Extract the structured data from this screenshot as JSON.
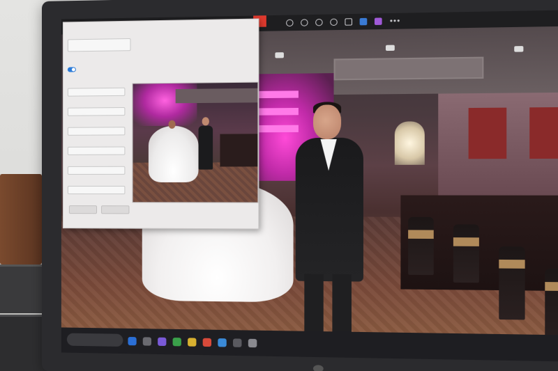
{
  "scene": {
    "description_visible_text": "",
    "dialog": {
      "title": "",
      "nav_arrows": ""
    }
  },
  "toolbar_icons": [
    "rotate-icon",
    "heart-icon",
    "info-icon",
    "edit-icon",
    "crop-icon",
    "cloud-icon",
    "app-icon",
    "more-icon"
  ],
  "taskbar_icons": [
    "windows-icon",
    "search-icon",
    "widgets-icon",
    "chat-icon",
    "explorer-icon",
    "edge-icon",
    "store-icon",
    "photos-icon",
    "mail-icon",
    "settings-icon"
  ],
  "colors": {
    "toolbar_red": "#e03a2e",
    "toggle_blue": "#2a7ad8",
    "neon_pink": "#ff4ad8"
  }
}
